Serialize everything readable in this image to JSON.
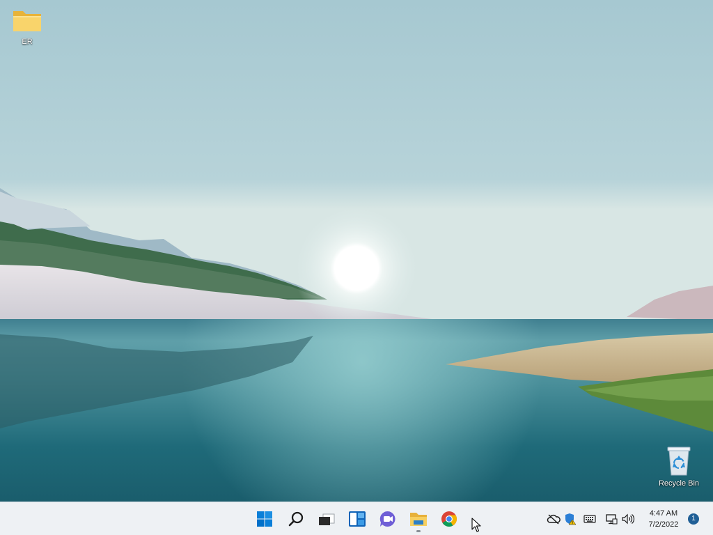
{
  "desktop": {
    "icons": [
      {
        "label": "ER",
        "icon": "folder-icon"
      },
      {
        "label": "Recycle Bin",
        "icon": "recycle-bin-icon"
      }
    ]
  },
  "taskbar": {
    "apps": [
      {
        "icon": "windows-start-icon",
        "running": false
      },
      {
        "icon": "search-icon",
        "running": false
      },
      {
        "icon": "task-view-icon",
        "running": false
      },
      {
        "icon": "widgets-icon",
        "running": false
      },
      {
        "icon": "teams-chat-icon",
        "running": false
      },
      {
        "icon": "file-explorer-icon",
        "running": true
      },
      {
        "icon": "chrome-icon",
        "running": false
      }
    ],
    "tray": {
      "icons": [
        "onedrive-offline-icon",
        "windows-security-warning-icon",
        "touch-keyboard-icon",
        "network-icon",
        "volume-icon"
      ]
    },
    "clock": {
      "time": "4:47 AM",
      "date": "7/2/2022"
    },
    "notifications": {
      "count": "1"
    }
  },
  "colors": {
    "taskbar_bg": "#eef1f4",
    "start_blue": "#0078d4",
    "badge_blue": "#1f5f96"
  }
}
